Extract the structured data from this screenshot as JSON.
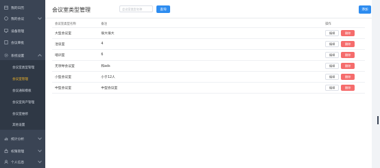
{
  "sidebar": {
    "items": [
      {
        "label": "我的日历",
        "icon": "calendar-icon"
      },
      {
        "label": "我的会议",
        "icon": "meeting-icon"
      },
      {
        "label": "设备管理",
        "icon": "device-icon"
      },
      {
        "label": "会议审批",
        "icon": "approve-icon"
      },
      {
        "label": "系统设置",
        "icon": "gear-icon",
        "expanded": true
      },
      {
        "label": "统计分析",
        "icon": "chart-icon"
      },
      {
        "label": "权限管理",
        "icon": "lock-icon"
      },
      {
        "label": "个人信息",
        "icon": "user-icon"
      }
    ],
    "sub_items": [
      {
        "label": "会议室类型管理"
      },
      {
        "label": "会议室管理",
        "active": true
      },
      {
        "label": "会议通知模板"
      },
      {
        "label": "会议室资产管理"
      },
      {
        "label": "会议室维修"
      },
      {
        "label": "其他设置"
      }
    ]
  },
  "header": {
    "title": "会议室类型管理",
    "search_label": "会议室类型名称",
    "search_placeholder": "会议室类型名称",
    "query_button": "查询",
    "add_button": "添加"
  },
  "table": {
    "columns": [
      "会议室类型名称",
      "备注",
      "操作"
    ],
    "rows": [
      {
        "name": "大型会议室",
        "note": "很大很大"
      },
      {
        "name": "洽谈室",
        "note": "4"
      },
      {
        "name": "培训室",
        "note": "6"
      },
      {
        "name": "无领导会议室",
        "note": "和ads"
      },
      {
        "name": "小型会议室",
        "note": "小于12人"
      },
      {
        "name": "中型会议室",
        "note": "中型会议室"
      }
    ],
    "edit_label": "编辑",
    "delete_label": "删除"
  },
  "colors": {
    "sidebar_bg": "#3a4454",
    "active_sub": "#f0b429",
    "primary": "#2d8cf0",
    "danger": "#f56c6c"
  }
}
